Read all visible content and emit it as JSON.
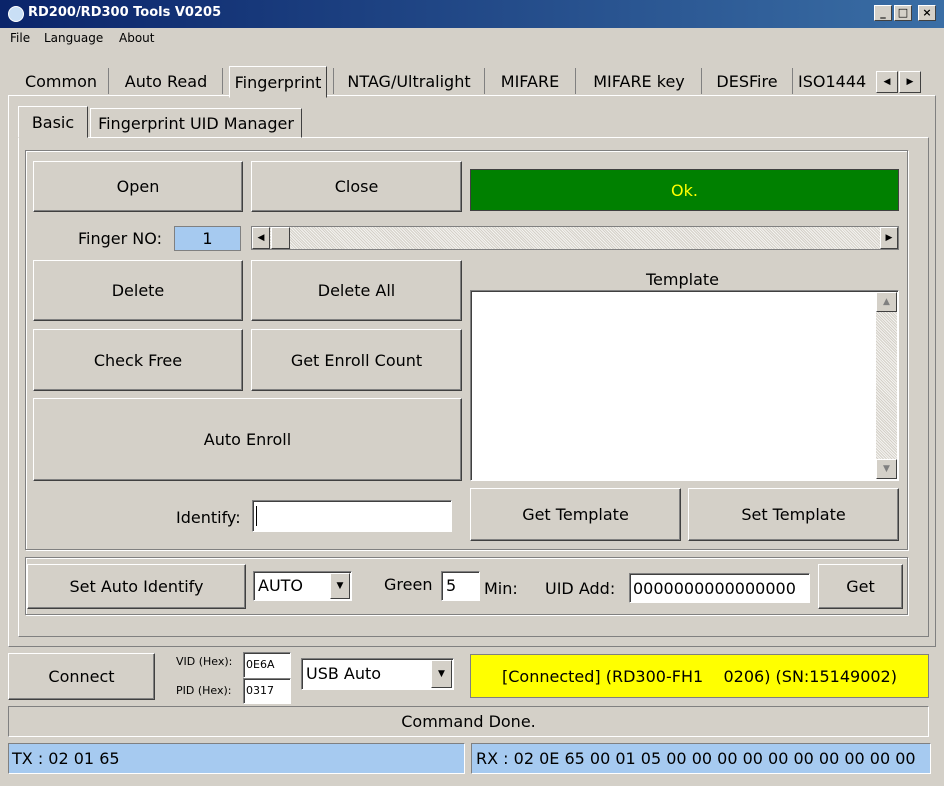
{
  "window": {
    "title": "RD200/RD300 Tools V0205",
    "minimize": "_",
    "maximize": "□",
    "close": "×"
  },
  "menu": [
    "File",
    "Language",
    "About"
  ],
  "tabs": [
    "Common",
    "Auto Read",
    "Fingerprint",
    "NTAG/Ultralight",
    "MIFARE",
    "MIFARE key",
    "DESFire",
    "ISO1444"
  ],
  "active_tab": "Fingerprint",
  "subtabs": [
    "Basic",
    "Fingerprint UID Manager"
  ],
  "active_subtab": "Basic",
  "fingerprint": {
    "open_label": "Open",
    "close_label": "Close",
    "status_text": "Ok.",
    "status_color": "#008000",
    "finger_no_label": "Finger NO:",
    "finger_no_value": "1",
    "delete_label": "Delete",
    "delete_all_label": "Delete All",
    "check_free_label": "Check Free",
    "get_enroll_count_label": "Get Enroll Count",
    "auto_enroll_label": "Auto Enroll",
    "identify_label": "Identify:",
    "identify_value": "",
    "template_label": "Template",
    "template_value": "",
    "get_template_label": "Get Template",
    "set_template_label": "Set Template"
  },
  "auto_identify": {
    "button_label": "Set Auto Identify",
    "mode_value": "AUTO",
    "green_label": "Green",
    "green_value": "5",
    "min_label": "Min:",
    "uid_add_label": "UID Add:",
    "uid_add_value": "0000000000000000",
    "get_label": "Get"
  },
  "connection": {
    "connect_label": "Connect",
    "vid_label": "VID (Hex):",
    "vid_value": "0E6A",
    "pid_label": "PID (Hex):",
    "pid_value": "0317",
    "port_value": "USB Auto",
    "status_text": "[Connected] (RD300-FH1    0206) (SN:15149002)",
    "status_color": "#ffff00"
  },
  "status": {
    "message": "Command Done.",
    "tx": "TX : 02 01 65",
    "rx": "RX : 02 0E 65 00 01 05 00 00 00 00 00 00 00 00 00 00"
  }
}
